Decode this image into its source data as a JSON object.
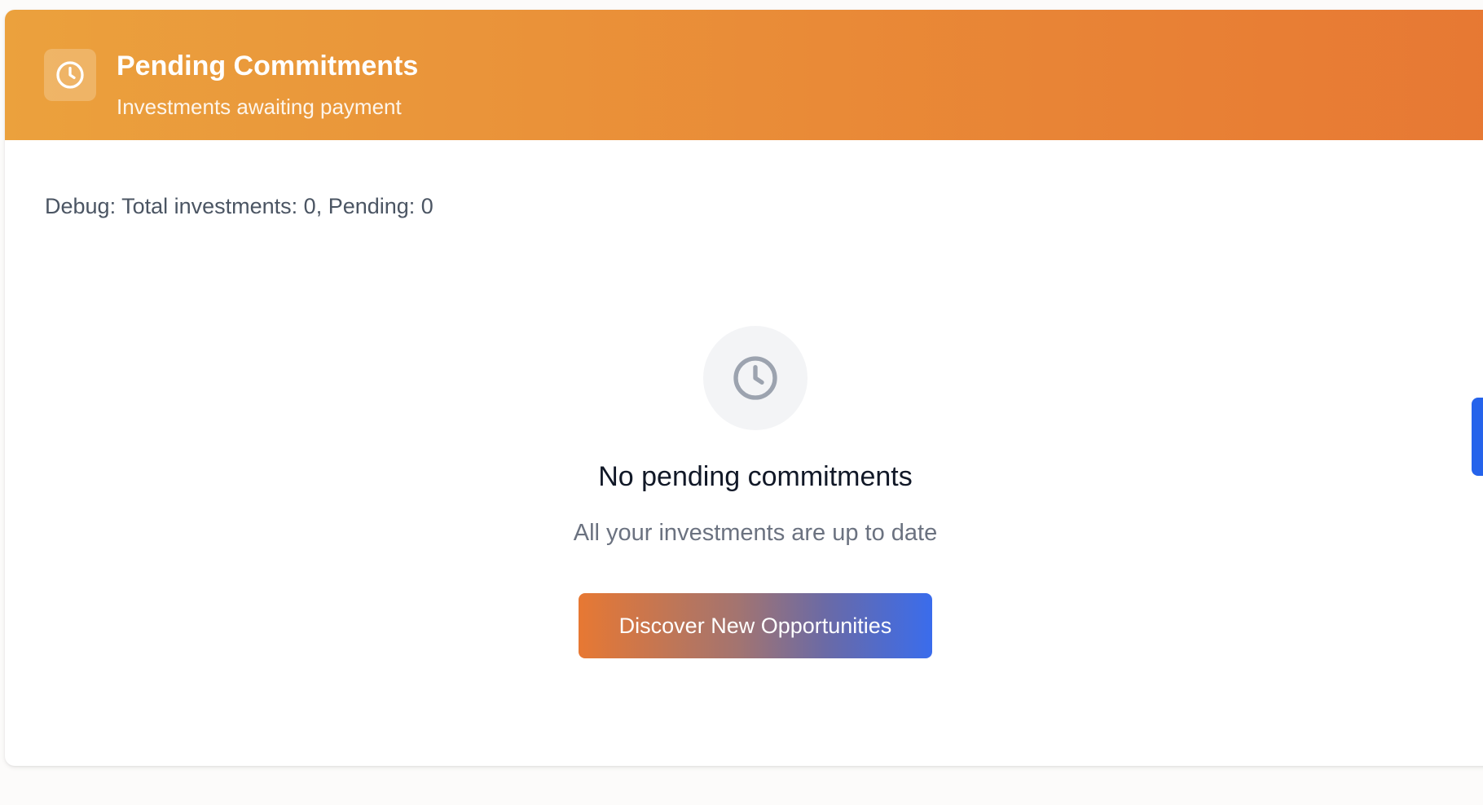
{
  "header": {
    "title": "Pending Commitments",
    "subtitle": "Investments awaiting payment",
    "icon": "clock-icon"
  },
  "debug": {
    "text": "Debug: Total investments: 0, Pending: 0"
  },
  "empty_state": {
    "icon": "clock-icon",
    "title": "No pending commitments",
    "subtitle": "All your investments are up to date",
    "button_label": "Discover New Opportunities"
  },
  "colors": {
    "header_gradient_start": "#eba13d",
    "header_gradient_end": "#e77833",
    "button_gradient_start": "#e77833",
    "button_gradient_end": "#3a6cec",
    "side_tab": "#2563eb"
  }
}
